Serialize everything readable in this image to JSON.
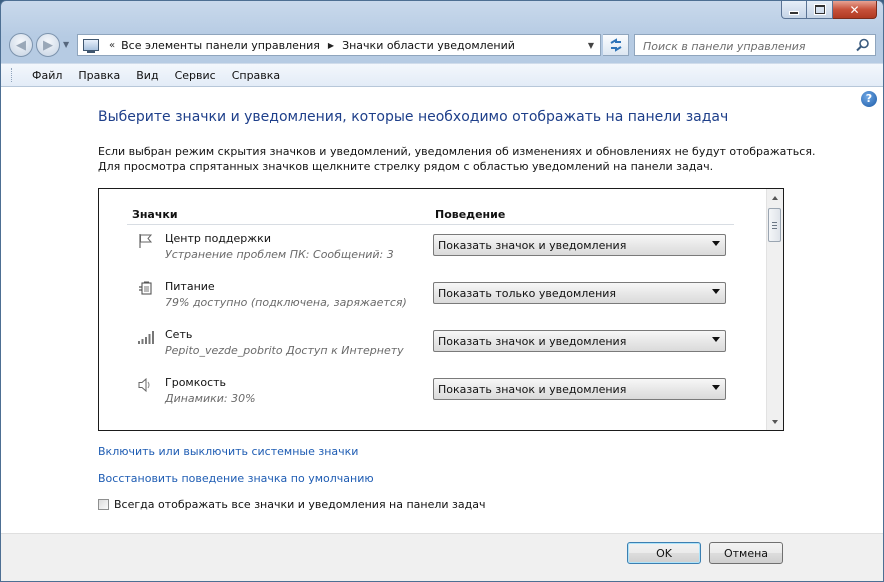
{
  "window": {
    "caption_buttons": {
      "minimize_icon": "minimize-icon",
      "maximize_icon": "maximize-icon",
      "close_icon": "close-icon"
    }
  },
  "address_bar": {
    "chevron": "«",
    "segments": [
      "Все элементы панели управления",
      "Значки области уведомлений"
    ],
    "separator": "▶"
  },
  "search": {
    "placeholder": "Поиск в панели управления"
  },
  "menu": {
    "items": [
      "Файл",
      "Правка",
      "Вид",
      "Сервис",
      "Справка"
    ]
  },
  "content": {
    "title": "Выберите значки и уведомления, которые необходимо отображать на панели задач",
    "description_line1": "Если выбран режим скрытия значков и уведомлений, уведомления об изменениях и обновлениях не будут отображаться.",
    "description_line2": "Для просмотра спрятанных значков щелкните стрелку рядом с областью уведомлений на панели задач.",
    "columns": {
      "icons": "Значки",
      "behavior": "Поведение"
    },
    "rows": [
      {
        "name": "Центр поддержки",
        "detail": "Устранение проблем ПК: Сообщений: 3",
        "behavior": "Показать значок и уведомления",
        "icon": "flag-icon"
      },
      {
        "name": "Питание",
        "detail": "79% доступно (подключена, заряжается)",
        "behavior": "Показать только уведомления",
        "icon": "power-plug-icon"
      },
      {
        "name": "Сеть",
        "detail": "Pepito_vezde_pobrito Доступ к Интернету",
        "behavior": "Показать значок и уведомления",
        "icon": "network-signal-icon"
      },
      {
        "name": "Громкость",
        "detail": "Динамики: 30%",
        "behavior": "Показать значок и уведомления",
        "icon": "speaker-icon"
      }
    ],
    "link_system_icons": "Включить или выключить системные значки",
    "link_restore": "Восстановить поведение значка по умолчанию",
    "checkbox_label": "Всегда отображать все значки и уведомления на панели задач",
    "checkbox_checked": false
  },
  "footer": {
    "ok": "OK",
    "cancel": "Отмена"
  },
  "colors": {
    "title": "#1e3f8a",
    "link": "#1e5cb3"
  }
}
